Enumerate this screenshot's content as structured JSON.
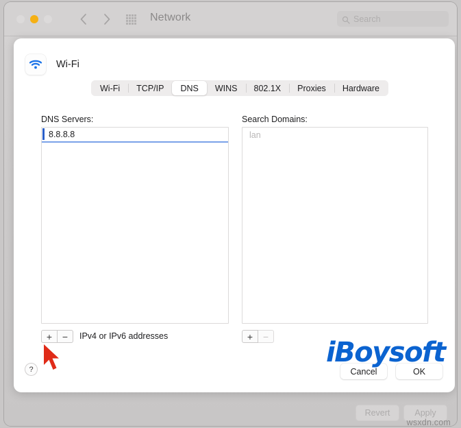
{
  "window": {
    "title": "Network",
    "traffic_lights": [
      "close",
      "minimize",
      "zoom"
    ],
    "nav": {
      "back": "back-chevron",
      "forward": "forward-chevron"
    },
    "grid_icon": "grid-icon",
    "search": {
      "placeholder": "Search",
      "icon": "search-icon",
      "value": ""
    },
    "footer": {
      "revert_label": "Revert",
      "apply_label": "Apply",
      "watermark": "wsxdn.com"
    }
  },
  "sheet": {
    "service": {
      "name": "Wi-Fi",
      "icon": "wifi-icon"
    },
    "tabs": [
      {
        "label": "Wi-Fi",
        "selected": false
      },
      {
        "label": "TCP/IP",
        "selected": false
      },
      {
        "label": "DNS",
        "selected": true
      },
      {
        "label": "WINS",
        "selected": false
      },
      {
        "label": "802.1X",
        "selected": false
      },
      {
        "label": "Proxies",
        "selected": false
      },
      {
        "label": "Hardware",
        "selected": false
      }
    ],
    "dns": {
      "label": "DNS Servers:",
      "entries": [
        "8.8.8.8"
      ],
      "hint": "IPv4 or IPv6 addresses",
      "add_label": "+",
      "remove_label": "−"
    },
    "search_domains": {
      "label": "Search Domains:",
      "placeholder": "lan",
      "entries": [],
      "add_label": "+",
      "remove_label": "−"
    },
    "help_label": "?",
    "cancel_label": "Cancel",
    "ok_label": "OK"
  },
  "overlay": {
    "brand_watermark": "iBoysoft",
    "cursor": "red-arrow-cursor"
  },
  "colors": {
    "accent_blue": "#2a5fc9",
    "brand_blue": "#0b63d0",
    "cursor_red": "#e02b18",
    "amber": "#f5b014"
  }
}
